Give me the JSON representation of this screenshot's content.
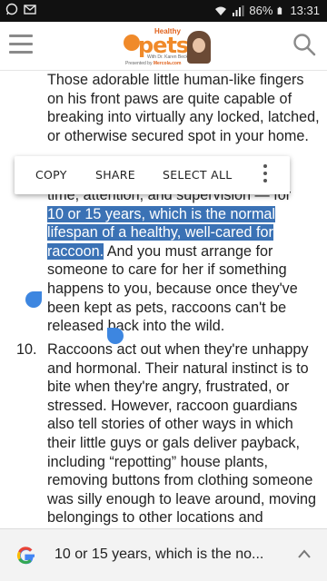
{
  "statusbar": {
    "battery": "86%",
    "time": "13:31",
    "icons": [
      "whatsapp-icon",
      "gmail-icon",
      "wifi-icon",
      "signal-icon",
      "battery-icon"
    ]
  },
  "appbar": {
    "logo_top": "Healthy",
    "logo_main": "pets",
    "logo_sub": "With Dr. Karen Becker",
    "logo_powered_prefix": "Presented by",
    "logo_powered_brand": "Mercola.com",
    "icons": [
      "menu-icon",
      "search-icon"
    ]
  },
  "article": {
    "para1": "Those adorable little human-like fingers on his front paws are quite capable of breaking into virtually any locked, latched, or otherwise secured spot in your home.",
    "para2_partial": "time, attention, and supervision — for",
    "para2_selected": "10 or 15 years, which is the normal lifespan of a healthy, well-cared for raccoon.",
    "para2_rest": " And you must arrange for someone to care for her if something happens to you, because once they've been kept as pets, raccoons can't be released back into the wild.",
    "item_number": "10.",
    "para3": "Raccoons act out when they're unhappy and hormonal. Their natural instinct is to bite when they're angry, frustrated, or stressed. However, raccoon guardians also tell stories of other ways in which their little guys or gals deliver payback, including “repotting” house plants, removing buttons from clothing someone was silly enough to leave around, moving belongings to other locations and"
  },
  "selection_toolbar": {
    "copy": "COPY",
    "share": "SHARE",
    "select_all": "SELECT ALL"
  },
  "google_bar": {
    "text": "10 or 15 years, which is the no..."
  },
  "colors": {
    "selection": "#3b72b5",
    "handle": "#3d86e0",
    "brand_orange": "#f08a2a"
  }
}
